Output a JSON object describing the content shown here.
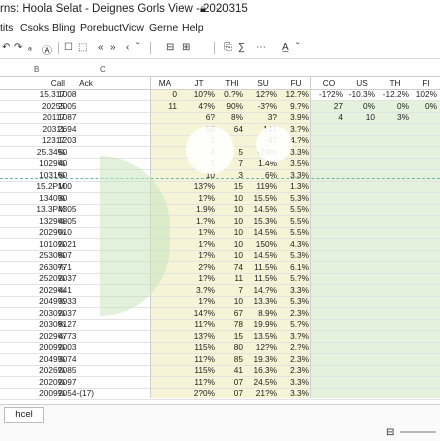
{
  "title_bar": {
    "title": "rns: Hoola Selat - Deignes Gorls View - 2020315",
    "lock_icon": "lock-icon",
    "arrow_icon": "chevron-down-icon"
  },
  "menu": [
    "tits",
    "Csoks",
    "Bling",
    "Porebuct",
    "Vicw",
    "Gerne",
    "Help"
  ],
  "toolbar": {
    "items": [
      "↶",
      "↷",
      "ₐ",
      "Ⓐ",
      "☐",
      "⬚",
      "«",
      "»",
      "‹",
      "ˇ",
      "⎘",
      "A̲",
      "ˇ",
      "⊟",
      "⊞",
      "∑",
      "⋯"
    ],
    "icons": [
      "undo-icon",
      "redo-icon",
      "font-icon",
      "format-icon",
      "box-icon",
      "border-icon",
      "prev-icon",
      "next-icon",
      "back-icon",
      "dropdown-icon",
      "copy-icon",
      "text-color-icon",
      "dropdown-icon",
      "collapse-icon",
      "expand-icon",
      "sum-icon",
      "more-icon"
    ]
  },
  "column_letters": [
    "B",
    "C"
  ],
  "header": [
    "Call",
    "Ack",
    "MA",
    "JT",
    "THI",
    "SU",
    "FU",
    "CO",
    "US",
    "TH",
    "FI"
  ],
  "rows": [
    [
      "15.317",
      "1008",
      "0",
      "10?%",
      "0.?%",
      "12?%",
      "12.?%",
      "-1?2%",
      "-10.3%",
      "-12.2%",
      "102%"
    ],
    [
      "20255",
      "2005",
      "11",
      "4?%",
      "90%",
      "-3?%",
      "9.?%",
      "27",
      "0%",
      "0%",
      "0%"
    ],
    [
      "20117",
      "1087",
      "",
      "6?",
      "8%",
      "3?",
      "3.9%",
      "4",
      "10",
      "3%",
      ""
    ],
    [
      "20311",
      "2694",
      "",
      "55",
      "64",
      "141",
      "3.?%",
      "",
      "",
      "",
      ""
    ],
    [
      "12317",
      "1203",
      "",
      "1",
      "",
      "-47",
      "4.?%",
      "",
      "",
      "",
      ""
    ],
    [
      "25.34%",
      "50",
      "",
      "4",
      "5",
      "-24%",
      "3.3%",
      "",
      "",
      "",
      ""
    ],
    [
      "1029%",
      "40",
      "",
      "3",
      "7",
      "1.4%",
      "3.5%",
      "",
      "",
      "",
      ""
    ],
    [
      "1031%",
      "60",
      "",
      "10",
      "3",
      "6%",
      "3.3%",
      "",
      "",
      "",
      ""
    ],
    [
      "15.2PM",
      "100",
      "",
      "13?%",
      "15",
      "119%",
      "1.3%",
      "",
      "",
      "",
      ""
    ],
    [
      "1340%",
      "30",
      "",
      "1?%",
      "10",
      "15.5%",
      "5.3%",
      "",
      "",
      "",
      ""
    ],
    [
      "13.3PM",
      "4305",
      "",
      "1.9%",
      "10",
      "14.5%",
      "5.5%",
      "",
      "",
      "",
      ""
    ],
    [
      "1329%",
      "4805",
      "",
      "1.?%",
      "10",
      "15.3%",
      "5.5%",
      "",
      "",
      "",
      ""
    ],
    [
      "2029%",
      "010",
      "",
      "1?%",
      "10",
      "14.5%",
      "5.5%",
      "",
      "",
      "",
      ""
    ],
    [
      "1010%",
      "2021",
      "",
      "1?%",
      "10",
      "150%",
      "4.3%",
      "",
      "",
      "",
      ""
    ],
    [
      "2530%",
      "807",
      "",
      "1?%",
      "10",
      "14.5%",
      "5.3%",
      "",
      "",
      "",
      ""
    ],
    [
      "2630%",
      "771",
      "",
      "2?%",
      "74",
      "11.5%",
      "6.1%",
      "",
      "",
      "",
      ""
    ],
    [
      "2520%",
      "2037",
      "",
      "1?%",
      "11",
      "11.5%",
      "5.?%",
      "",
      "",
      "",
      ""
    ],
    [
      "2029%",
      "441",
      "",
      "3.?%",
      "7",
      "14.?%",
      "3.3%",
      "",
      "",
      "",
      ""
    ],
    [
      "2049%",
      "3933",
      "",
      "1?%",
      "10",
      "13.3%",
      "5.3%",
      "",
      "",
      "",
      ""
    ],
    [
      "2030%",
      "2037",
      "",
      "14?%",
      "67",
      "8.9%",
      "2.3%",
      "",
      "",
      "",
      ""
    ],
    [
      "2030%",
      "8127",
      "",
      "11?%",
      "78",
      "19.9%",
      "5.?%",
      "",
      "",
      "",
      ""
    ],
    [
      "2029%",
      "4773",
      "",
      "13?%",
      "15",
      "13.5%",
      "3.?%",
      "",
      "",
      "",
      ""
    ],
    [
      "2009%",
      "2003",
      "",
      "115%",
      "80",
      "12?%",
      "2.?%",
      "",
      "",
      "",
      ""
    ],
    [
      "2049%",
      "3074",
      "",
      "11?%",
      "85",
      "19.3%",
      "2.3%",
      "",
      "",
      "",
      ""
    ],
    [
      "2026%",
      "2085",
      "",
      "115%",
      "41",
      "16.3%",
      "2.3%",
      "",
      "",
      "",
      ""
    ],
    [
      "2020%",
      "2097",
      "",
      "11?%",
      "07",
      "24.5%",
      "3.3%",
      "",
      "",
      "",
      ""
    ],
    [
      "2009%",
      "2054-(17)",
      "",
      "2?0%",
      "07",
      "21?%",
      "3.3%",
      "",
      "",
      "",
      ""
    ]
  ],
  "sheet_tab": "hcel"
}
